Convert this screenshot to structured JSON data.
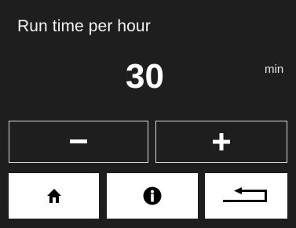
{
  "screen": {
    "title": "Run time per hour",
    "value": "30",
    "unit": "min"
  },
  "controls": {
    "decrement_icon": "minus-icon",
    "increment_icon": "plus-icon"
  },
  "nav": {
    "home_icon": "home-icon",
    "info_icon": "info-icon",
    "back_icon": "return-arrow-icon"
  },
  "colors": {
    "background": "#1e1e1e",
    "text": "#ffffff",
    "button_face": "#ffffff",
    "icon": "#000000",
    "outline": "#d8d8d8"
  }
}
